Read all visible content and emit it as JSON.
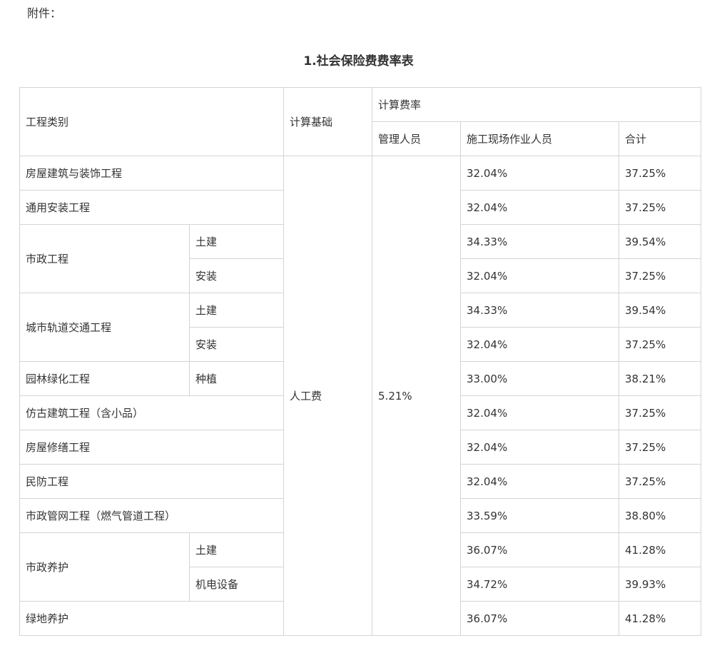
{
  "attachment_label": "附件：",
  "title": "1.社会保险费费率表",
  "header": {
    "category": "工程类别",
    "basis": "计算基础",
    "rate": "计算费率",
    "manager": "管理人员",
    "worker": "施工现场作业人员",
    "total": "合计"
  },
  "basis_value": "人工费",
  "manager_rate": "5.21%",
  "rows": [
    {
      "category": "房屋建筑与装饰工程",
      "worker": "32.04%",
      "total": "37.25%"
    },
    {
      "category": "通用安装工程",
      "worker": "32.04%",
      "total": "37.25%"
    },
    {
      "category": "市政工程",
      "sub": "土建",
      "worker": "34.33%",
      "total": "39.54%"
    },
    {
      "sub": "安装",
      "worker": "32.04%",
      "total": "37.25%"
    },
    {
      "category": "城市轨道交通工程",
      "sub": "土建",
      "worker": "34.33%",
      "total": "39.54%"
    },
    {
      "sub": "安装",
      "worker": "32.04%",
      "total": "37.25%"
    },
    {
      "category": "园林绿化工程",
      "sub": "种植",
      "worker": "33.00%",
      "total": "38.21%"
    },
    {
      "category": "仿古建筑工程（含小品）",
      "worker": "32.04%",
      "total": "37.25%"
    },
    {
      "category": "房屋修缮工程",
      "worker": "32.04%",
      "total": "37.25%"
    },
    {
      "category": "民防工程",
      "worker": "32.04%",
      "total": "37.25%"
    },
    {
      "category": "市政管网工程（燃气管道工程）",
      "worker": "33.59%",
      "total": "38.80%"
    },
    {
      "category": "市政养护",
      "sub": "土建",
      "worker": "36.07%",
      "total": "41.28%"
    },
    {
      "sub": "机电设备",
      "worker": "34.72%",
      "total": "39.93%"
    },
    {
      "category": "绿地养护",
      "worker": "36.07%",
      "total": "41.28%"
    }
  ]
}
